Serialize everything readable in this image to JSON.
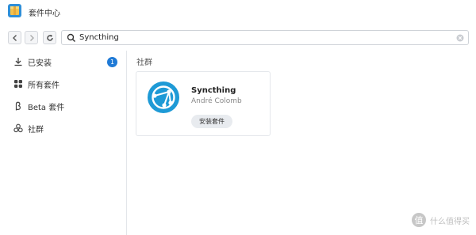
{
  "window": {
    "title": "套件中心"
  },
  "toolbar": {
    "back_icon": "chevron-left-icon",
    "forward_icon": "chevron-right-icon",
    "refresh_icon": "refresh-icon",
    "search": {
      "value": "Syncthing",
      "icon": "search-icon",
      "clear_icon": "clear-icon"
    }
  },
  "sidebar": {
    "items": [
      {
        "label": "已安装",
        "icon": "download-icon",
        "badge": "1"
      },
      {
        "label": "所有套件",
        "icon": "grid-icon"
      },
      {
        "label": "Beta 套件",
        "icon": "beta-icon"
      },
      {
        "label": "社群",
        "icon": "community-icon"
      }
    ]
  },
  "main": {
    "section_title": "社群",
    "package": {
      "name": "Syncthing",
      "author": "André Colomb",
      "install_label": "安装套件",
      "logo": "syncthing-logo"
    }
  },
  "watermark": {
    "text": "什么值得买"
  },
  "colors": {
    "accent": "#1f7ad6",
    "logo_blue": "#1e9ad6"
  }
}
